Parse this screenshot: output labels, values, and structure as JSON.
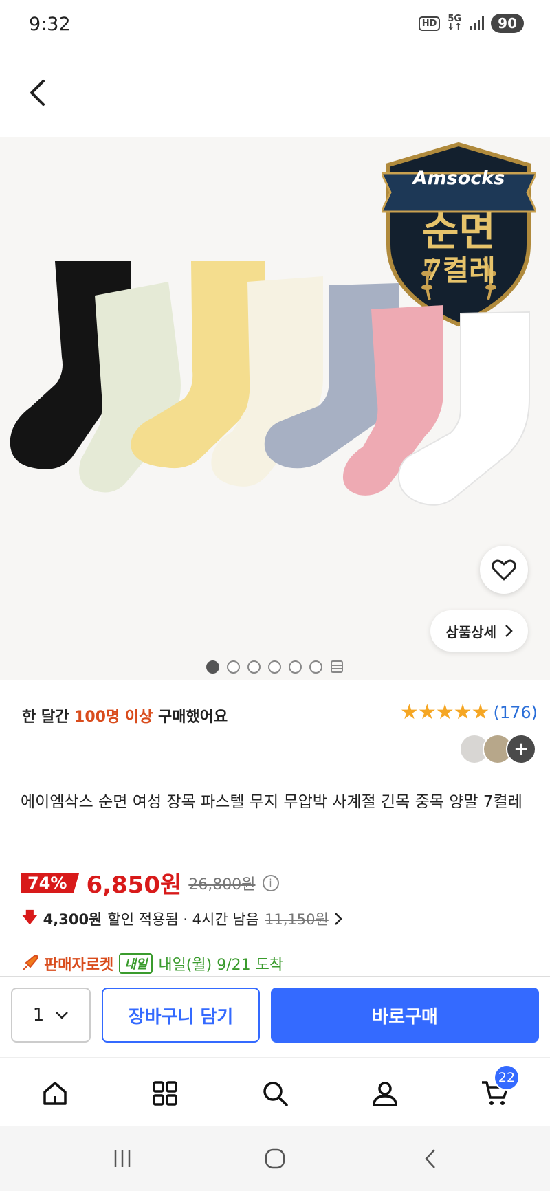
{
  "status_bar": {
    "time": "9:32",
    "hd": "HD",
    "network": "5G",
    "battery": "90"
  },
  "hero": {
    "badge_brand": "Amsocks",
    "badge_line1": "순면",
    "badge_line2": "7켤레",
    "detail_button": "상품상세",
    "slide_count": 6,
    "active_slide": 1
  },
  "summary": {
    "sales_prefix": "한 달간 ",
    "sales_highlight": "100명 이상",
    "sales_suffix": " 구매했어요",
    "rating": 5,
    "review_count": "(176)"
  },
  "product": {
    "title": "에이엠삭스 순면 여성 장목 파스텔 무지 무압박 사계절 긴목 중목 양말 7켤레"
  },
  "price": {
    "discount": "74%",
    "sale_price": "6,850원",
    "original_price": "26,800원"
  },
  "coupon": {
    "amount": "4,300원",
    "text": "할인 적용됨 · 4시간 남음",
    "before_price": "11,150원"
  },
  "delivery": {
    "rocket_label": "판매자로켓",
    "tomorrow_badge": "내일",
    "arrival": "내일(월) 9/21 도착"
  },
  "actions": {
    "quantity": "1",
    "cart_button": "장바구니 담기",
    "buy_button": "바로구매"
  },
  "bottom_nav": {
    "cart_count": "22"
  },
  "colors": {
    "accent_blue": "#346aff",
    "sale_red": "#d81a1a",
    "star_orange": "#f5a623",
    "delivery_green": "#3a9b2d"
  }
}
